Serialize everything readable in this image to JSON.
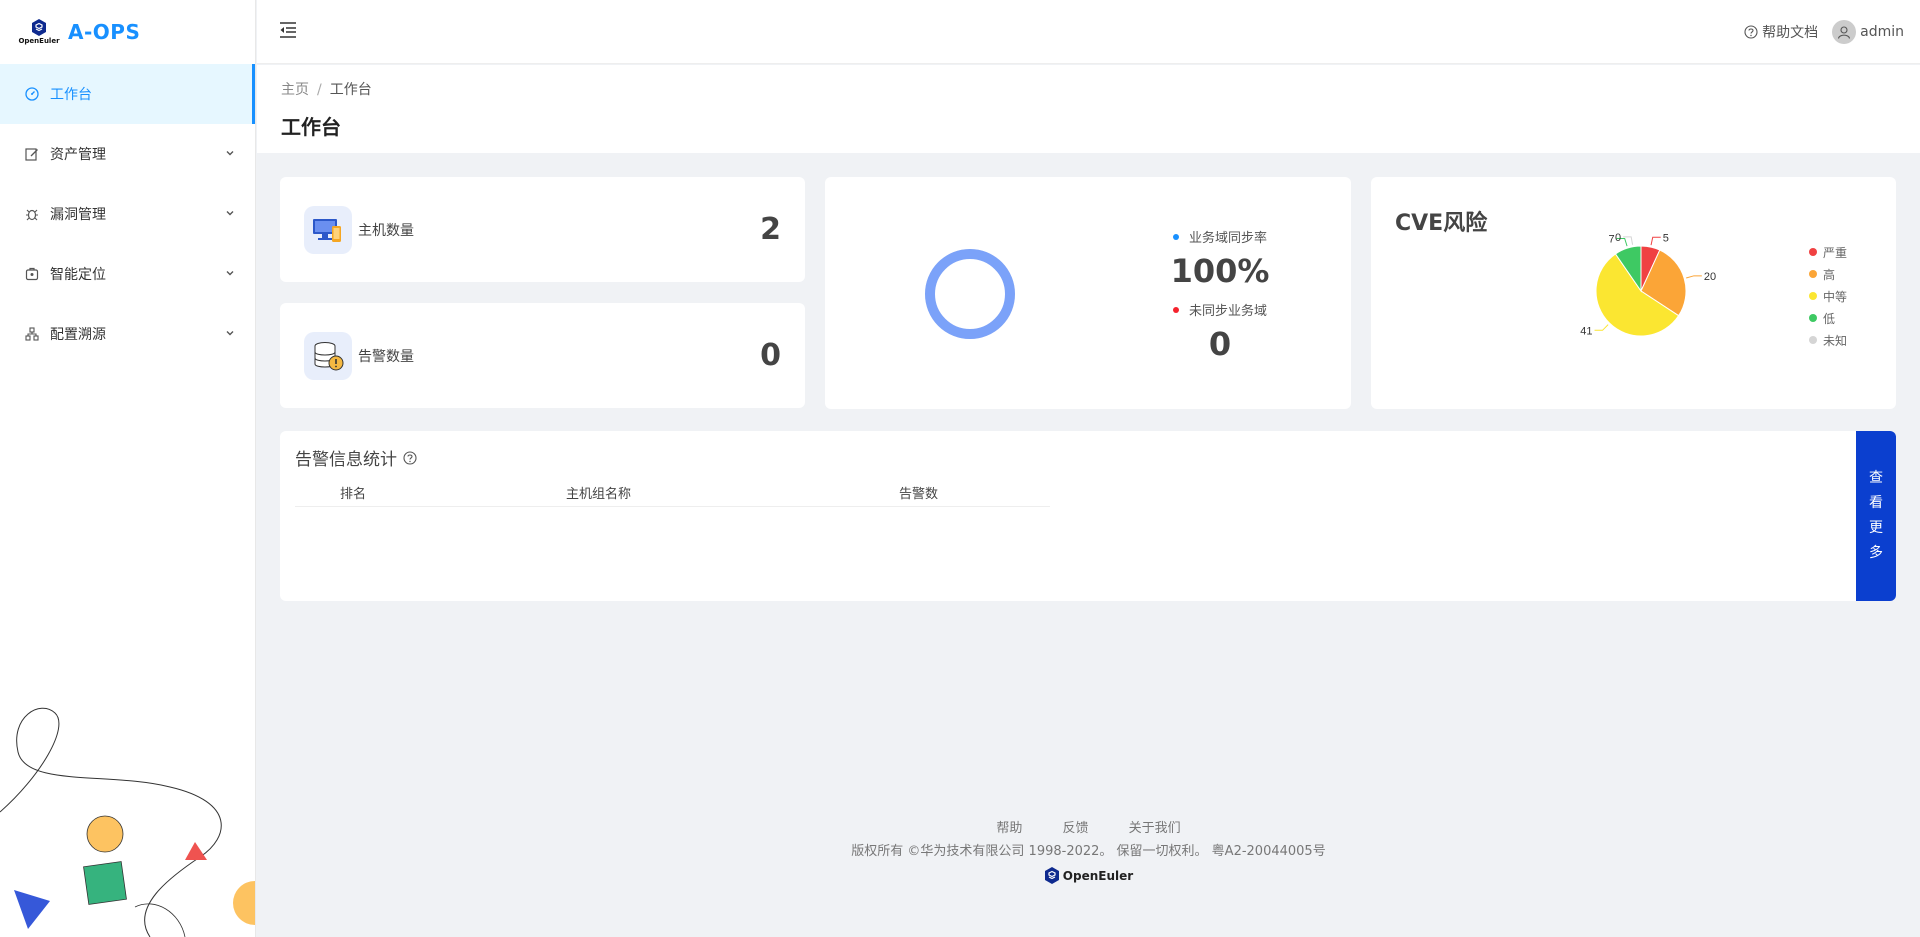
{
  "app": {
    "logo_text": "OpenEuler",
    "title": "A-OPS"
  },
  "sidebar": {
    "items": [
      {
        "label": "工作台",
        "icon": "dashboard-icon",
        "active": true
      },
      {
        "label": "资产管理",
        "icon": "edit-icon"
      },
      {
        "label": "漏洞管理",
        "icon": "bug-icon"
      },
      {
        "label": "智能定位",
        "icon": "locate-icon"
      },
      {
        "label": "配置溯源",
        "icon": "cluster-icon"
      }
    ]
  },
  "header": {
    "help_label": "帮助文档",
    "user_label": "admin"
  },
  "breadcrumb": {
    "home": "主页",
    "separator": "/",
    "current": "工作台"
  },
  "page": {
    "title": "工作台"
  },
  "stats": {
    "hosts": {
      "label": "主机数量",
      "value": "2"
    },
    "alerts": {
      "label": "告警数量",
      "value": "0"
    }
  },
  "sync": {
    "rate_label": "业务域同步率",
    "rate_value": "100%",
    "rate_fraction": 1.0,
    "unsynced_label": "未同步业务域",
    "unsynced_value": "0",
    "ring_color": "#7ba2f9"
  },
  "cve": {
    "title": "CVE风险",
    "legend": [
      {
        "label": "严重",
        "color": "#f04142"
      },
      {
        "label": "高",
        "color": "#fba537"
      },
      {
        "label": "中等",
        "color": "#fbe631"
      },
      {
        "label": "低",
        "color": "#3ec963"
      },
      {
        "label": "未知",
        "color": "#d5d5d5"
      }
    ]
  },
  "chart_data": {
    "type": "pie",
    "categories": [
      "严重",
      "高",
      "中等",
      "低",
      "未知"
    ],
    "values": [
      5,
      20,
      41,
      7,
      0
    ],
    "colors": [
      "#f04142",
      "#fba537",
      "#fbe631",
      "#3ec963",
      "#d5d5d5"
    ],
    "data_labels": [
      "5",
      "20",
      "41",
      "7",
      "0"
    ],
    "title": "CVE风险",
    "legend_position": "right"
  },
  "alert_stats": {
    "title": "告警信息统计",
    "columns": [
      "排名",
      "主机组名称",
      "告警数"
    ],
    "rows": [],
    "more_button": [
      "查",
      "看",
      "更",
      "多"
    ]
  },
  "footer": {
    "links": [
      "帮助",
      "反馈",
      "关于我们"
    ],
    "copyright": "版权所有 ©华为技术有限公司 1998-2022。 保留一切权利。 粤A2-20044005号",
    "logo_text": "OpenEuler"
  }
}
